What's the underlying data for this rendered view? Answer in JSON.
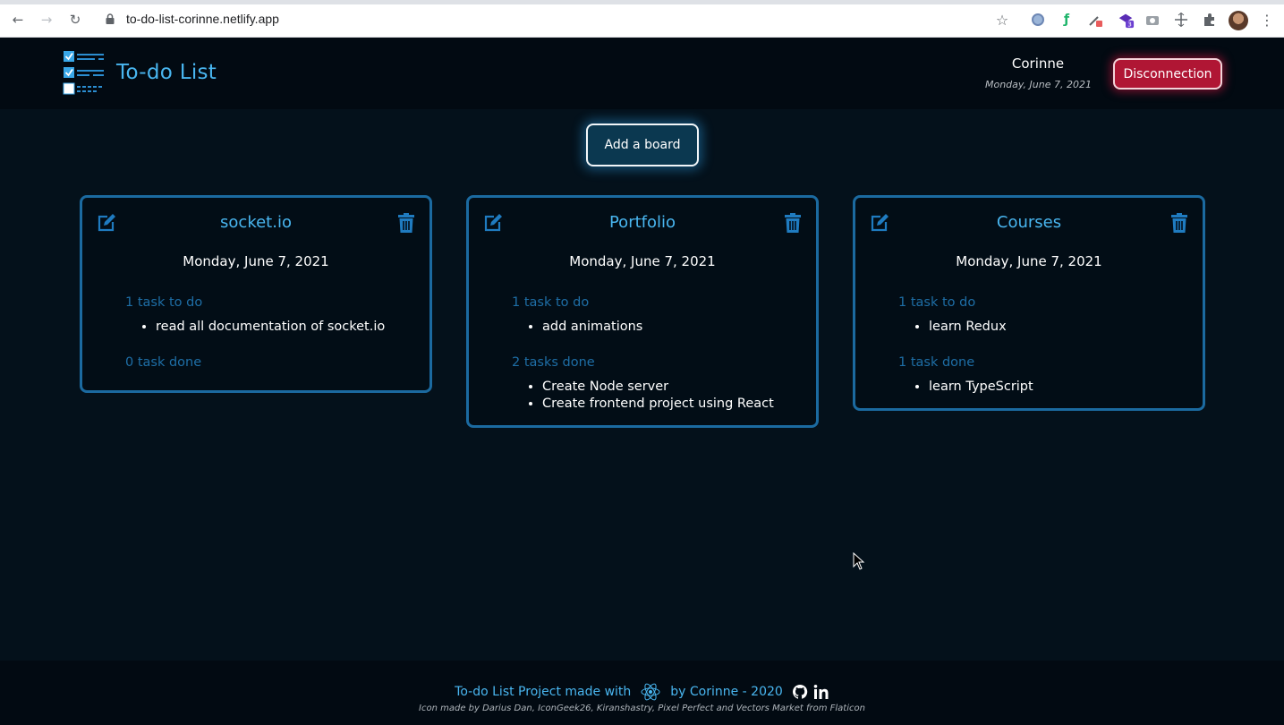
{
  "browser": {
    "url": "to-do-list-corinne.netlify.app",
    "nav_back": "←",
    "nav_forward": "→",
    "nav_reload": "↻",
    "bookmark": "☆",
    "menu": "⋮",
    "extensions": [
      "tab-icon",
      "feather-icon",
      "colorpick-icon",
      "badge-3-icon",
      "camera-icon",
      "move-icon",
      "puzzle-icon"
    ],
    "ext_badge": "3"
  },
  "header": {
    "title": "To-do List",
    "user_name": "Corinne",
    "user_date": "Monday, June 7, 2021",
    "disconnect_label": "Disconnection"
  },
  "main": {
    "add_board_label": "Add a board"
  },
  "boards": [
    {
      "title": "socket.io",
      "date": "Monday, June 7, 2021",
      "todo_label": "1 task to do",
      "todo_items": [
        "read all documentation of socket.io"
      ],
      "done_label": "0 task done",
      "done_items": []
    },
    {
      "title": "Portfolio",
      "date": "Monday, June 7, 2021",
      "todo_label": "1 task to do",
      "todo_items": [
        "add animations"
      ],
      "done_label": "2 tasks done",
      "done_items": [
        "Create Node server",
        "Create frontend project using React"
      ]
    },
    {
      "title": "Courses",
      "date": "Monday, June 7, 2021",
      "todo_label": "1 task to do",
      "todo_items": [
        "learn Redux"
      ],
      "done_label": "1 task done",
      "done_items": [
        "learn TypeScript"
      ]
    }
  ],
  "footer": {
    "made_with": "To-do List Project made with",
    "by": "by Corinne - 2020",
    "credit": "Icon made by Darius Dan, IconGeek26, Kiranshastry, Pixel Perfect and Vectors Market from Flaticon"
  },
  "colors": {
    "accent": "#49b6f0",
    "board_border": "#1b6aa0",
    "section_label": "#1e6ea6",
    "danger": "#b01634",
    "background": "#04111b"
  }
}
